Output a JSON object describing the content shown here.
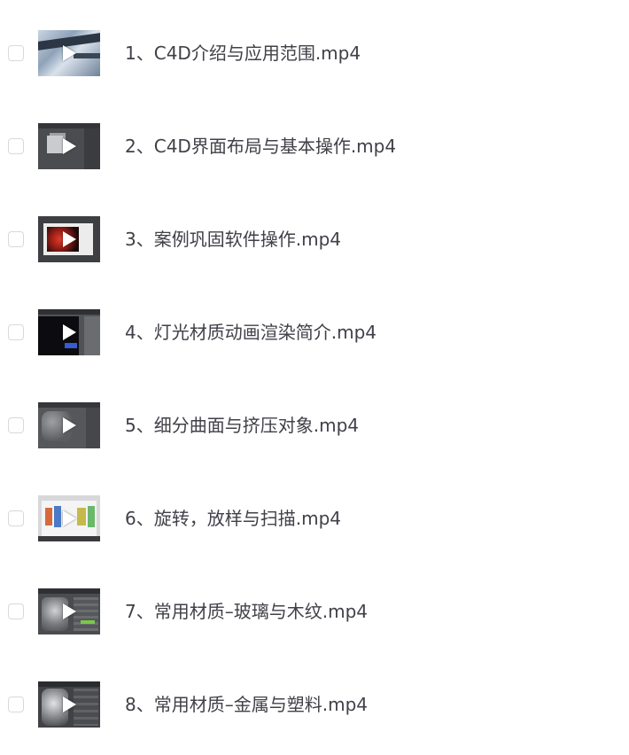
{
  "files": [
    {
      "name": "1、C4D介绍与应用范围.mp4",
      "thumb": "video-thumbnail"
    },
    {
      "name": "2、C4D界面布局与基本操作.mp4",
      "thumb": "video-thumbnail"
    },
    {
      "name": "3、案例巩固软件操作.mp4",
      "thumb": "video-thumbnail"
    },
    {
      "name": "4、灯光材质动画渲染简介.mp4",
      "thumb": "video-thumbnail"
    },
    {
      "name": "5、细分曲面与挤压对象.mp4",
      "thumb": "video-thumbnail"
    },
    {
      "name": "6、旋转，放样与扫描.mp4",
      "thumb": "video-thumbnail"
    },
    {
      "name": "7、常用材质–玻璃与木纹.mp4",
      "thumb": "video-thumbnail"
    },
    {
      "name": "8、常用材质–金属与塑料.mp4",
      "thumb": "video-thumbnail"
    }
  ],
  "icons": {
    "play": "play-icon",
    "checkbox": "checkbox-unchecked"
  },
  "colors": {
    "text": "#404048",
    "checkbox_border": "#d9d9dd",
    "background": "#ffffff"
  }
}
